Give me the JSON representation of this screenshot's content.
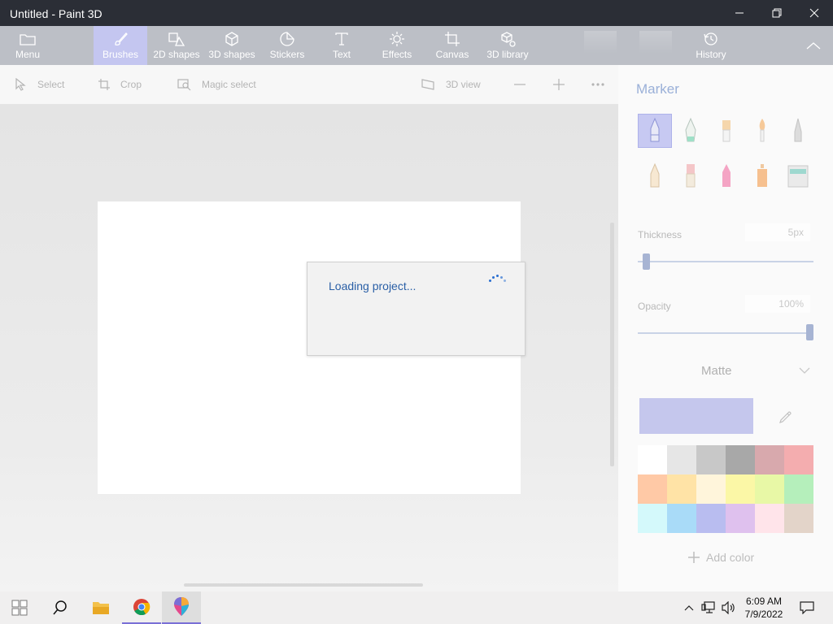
{
  "window": {
    "title": "Untitled - Paint 3D"
  },
  "ribbon": {
    "items": [
      {
        "label": "Menu",
        "icon": "folder-icon"
      },
      {
        "label": "Brushes",
        "icon": "brush-icon",
        "active": true
      },
      {
        "label": "2D shapes",
        "icon": "2d-shapes-icon"
      },
      {
        "label": "3D shapes",
        "icon": "cube-icon"
      },
      {
        "label": "Stickers",
        "icon": "sticker-icon"
      },
      {
        "label": "Text",
        "icon": "text-icon"
      },
      {
        "label": "Effects",
        "icon": "sun-icon"
      },
      {
        "label": "Canvas",
        "icon": "canvas-icon"
      },
      {
        "label": "3D library",
        "icon": "3d-library-icon"
      },
      {
        "label": "History",
        "icon": "history-icon"
      }
    ],
    "active_color": "#c4c6f0"
  },
  "toolbar": {
    "select": "Select",
    "crop": "Crop",
    "magic_select": "Magic select",
    "view_3d": "3D view"
  },
  "dialog": {
    "message": "Loading project..."
  },
  "panel": {
    "title": "Marker",
    "thickness_label": "Thickness",
    "thickness_value": "5px",
    "thickness_level": 0.05,
    "opacity_label": "Opacity",
    "opacity_value": "100%",
    "opacity_level": 1.0,
    "finish": "Matte",
    "current_color": "#c5c7ed",
    "add_color": "Add color",
    "brushes": [
      "marker",
      "calligraphy-pen",
      "oil-brush",
      "watercolor",
      "pixel-pen",
      "pencil",
      "eraser",
      "crayon",
      "spray-can",
      "fill"
    ],
    "palette": [
      "#ffffff",
      "#e6e6e6",
      "#c8c8c8",
      "#a8a8a8",
      "#d8a9ad",
      "#f4adaf",
      "#ffc9a6",
      "#ffe3a6",
      "#fff5db",
      "#fbf7a6",
      "#e8f8a6",
      "#b5efbb",
      "#d4f9fb",
      "#a9dbf8",
      "#b9bdf0",
      "#dfc1ee",
      "#ffe4ea",
      "#e3d4c9"
    ]
  },
  "taskbar": {
    "time": "6:09 AM",
    "date": "7/9/2022"
  }
}
